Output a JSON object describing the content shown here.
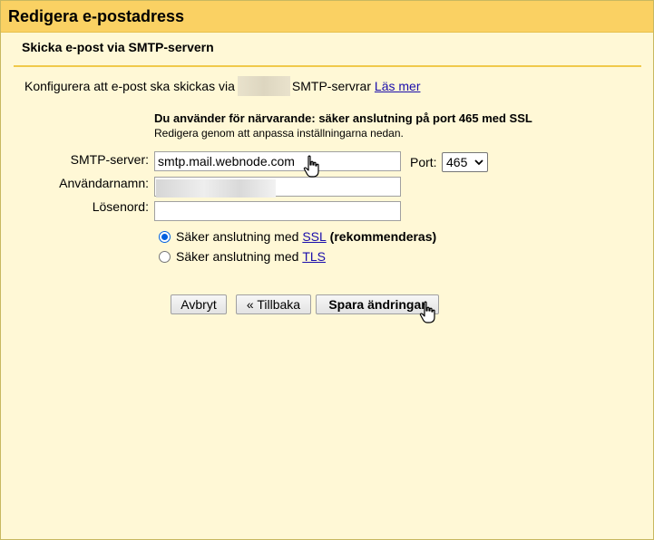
{
  "dialog": {
    "title": "Redigera e-postadress",
    "subtitle": "Skicka e-post via SMTP-servern"
  },
  "info": {
    "prefix": "Konfigurera att e-post ska skickas via",
    "suffix": "SMTP-servrar",
    "learn_more": "Läs mer"
  },
  "status": {
    "headline": "Du använder för närvarande: säker anslutning på port 465 med SSL",
    "hint": "Redigera genom att anpassa inställningarna nedan."
  },
  "form": {
    "smtp_label": "SMTP-server:",
    "smtp_value": "smtp.mail.webnode.com",
    "port_label": "Port:",
    "port_value": "465",
    "username_label": "Användarnamn:",
    "password_label": "Lösenord:"
  },
  "security": {
    "ssl_prefix": "Säker anslutning med",
    "ssl_link": "SSL",
    "ssl_suffix": "(rekommenderas)",
    "ssl_selected": true,
    "tls_prefix": "Säker anslutning med",
    "tls_link": "TLS",
    "tls_selected": false
  },
  "buttons": {
    "cancel": "Avbryt",
    "back": "« Tillbaka",
    "save": "Spara ändringar"
  },
  "colors": {
    "title_bar": "#fad163",
    "dialog_bg": "#fff8d6",
    "link": "#1a0dab",
    "radio_accent": "#0060df"
  },
  "icons": {
    "cursor": "hand-pointer-icon",
    "port_dropdown": "chevron-down-icon"
  }
}
